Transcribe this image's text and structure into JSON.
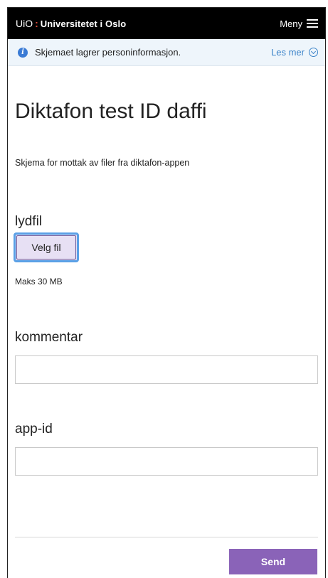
{
  "header": {
    "logo_short": "UiO",
    "logo_separator": ":",
    "logo_name": "Universitetet i Oslo",
    "menu_label": "Meny"
  },
  "info_bar": {
    "text": "Skjemaet lagrer personinformasjon.",
    "link_label": "Les mer"
  },
  "form": {
    "title": "Diktafon test ID daffi",
    "description": "Skjema for mottak av filer fra diktafon-appen",
    "fields": {
      "lydfil": {
        "label": "lydfil",
        "button_label": "Velg fil",
        "hint": "Maks 30 MB"
      },
      "kommentar": {
        "label": "kommentar",
        "value": ""
      },
      "app_id": {
        "label": "app-id",
        "value": ""
      }
    },
    "submit_label": "Send"
  },
  "colors": {
    "header_bg": "#000000",
    "brand_red": "#e14b3b",
    "info_bg": "#eef5fb",
    "link_blue": "#3b83c9",
    "send_purple": "#8a63b8",
    "file_button_bg": "#e7e0f4"
  },
  "icons": {
    "info": "info-circle-icon",
    "menu": "hamburger-menu-icon",
    "expand": "chevron-down-circle-icon"
  }
}
